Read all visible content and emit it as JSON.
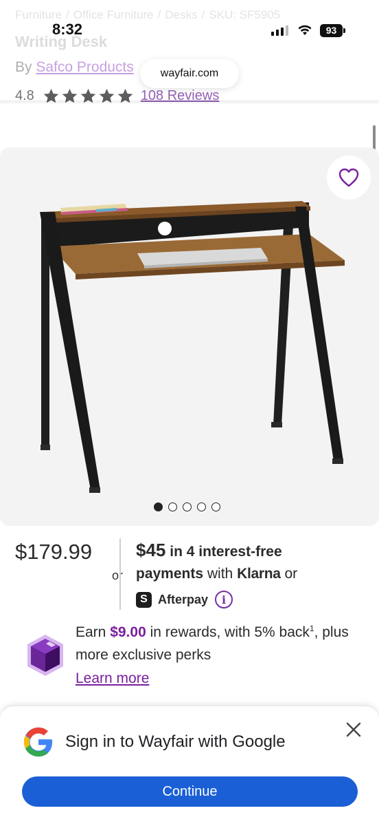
{
  "status_bar": {
    "time": "8:32",
    "battery": "93",
    "url": "wayfair.com"
  },
  "breadcrumb": [
    "Furniture",
    "Office Furniture",
    "Desks",
    "SKU: SF5905"
  ],
  "breadcrumb_separator": "/",
  "product": {
    "title": "Writing Desk",
    "by_prefix": "By",
    "brand": "Safco Products",
    "rating": "4.8",
    "stars": 5,
    "reviews": "108 Reviews"
  },
  "gallery": {
    "image_count": 5,
    "active_index": 0,
    "favorite_icon": "heart-outline-icon"
  },
  "pricing": {
    "price": "$179.99",
    "or_left": "or",
    "installment_amount": "$45",
    "installment_text": "in 4 interest-free",
    "payments_label": "payments",
    "with_text": "with",
    "klarna": "Klarna",
    "or_right": "or",
    "afterpay_badge": "S",
    "afterpay": "Afterpay",
    "info_icon": "i"
  },
  "rewards": {
    "earn_prefix": "Earn",
    "amount": "$9.00",
    "line1_rest": "in rewards, with 5% back",
    "footnote": "1",
    "line1_end": ", plus",
    "line2": "more exclusive perks",
    "learn_more": "Learn more"
  },
  "google_sheet": {
    "title": "Sign in to Wayfair with Google",
    "button": "Continue"
  },
  "colors": {
    "brand_purple": "#7a1f9e",
    "google_blue": "#1a5fd6",
    "gallery_bg": "#f4f3f3"
  }
}
